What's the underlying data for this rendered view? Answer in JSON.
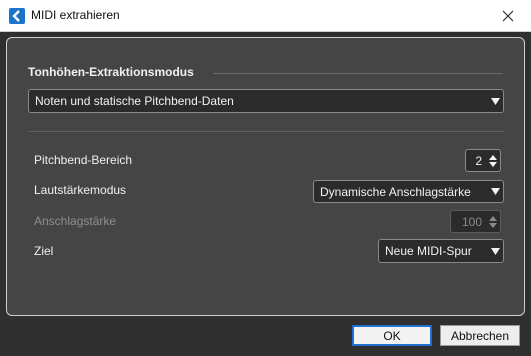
{
  "window": {
    "title": "MIDI extrahieren"
  },
  "section": {
    "title": "Tonhöhen-Extraktionsmodus"
  },
  "extraction_mode": {
    "selected": "Noten und statische Pitchbend-Daten"
  },
  "settings": {
    "pitchbend_range_label": "Pitchbend-Bereich",
    "pitchbend_range_value": "2",
    "volume_mode_label": "Lautstärkemodus",
    "volume_mode_value": "Dynamische Anschlagstärke",
    "velocity_label": "Anschlagstärke",
    "velocity_value": "100",
    "target_label": "Ziel",
    "target_value": "Neue MIDI-Spur"
  },
  "buttons": {
    "ok": "OK",
    "cancel": "Abbrechen"
  },
  "colors": {
    "background": "#2f2f2f",
    "panel": "#454545",
    "accent": "#1f6fcf"
  },
  "icons": [
    "app-icon",
    "close-icon",
    "chevron-down-icon",
    "spin-up-icon",
    "spin-down-icon"
  ]
}
